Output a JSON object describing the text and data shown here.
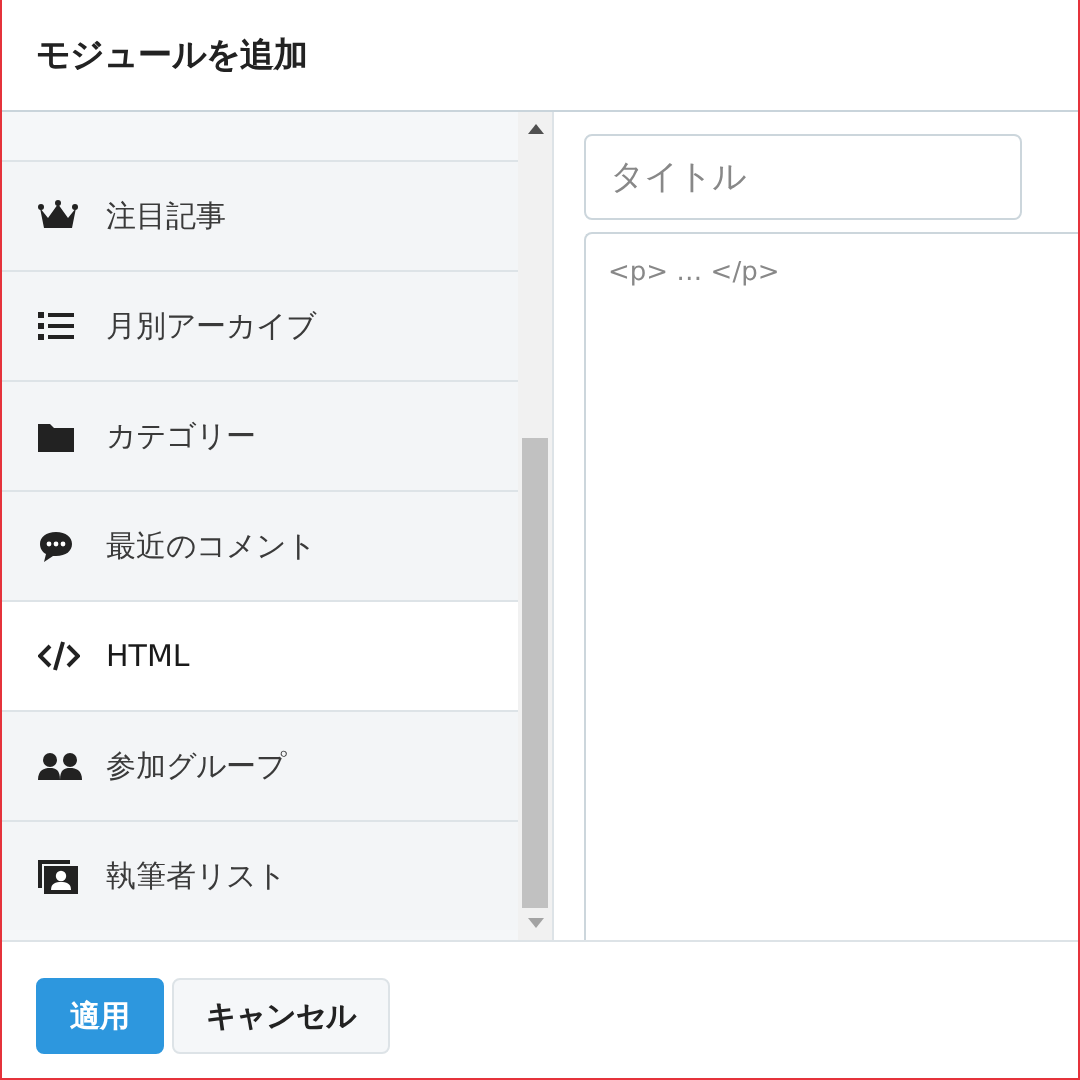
{
  "dialog": {
    "title": "モジュールを追加"
  },
  "modules": [
    {
      "label": "注目記事",
      "kind": "crown",
      "selected": false
    },
    {
      "label": "月別アーカイブ",
      "kind": "list",
      "selected": false
    },
    {
      "label": "カテゴリー",
      "kind": "folder",
      "selected": false
    },
    {
      "label": "最近のコメント",
      "kind": "comment",
      "selected": false
    },
    {
      "label": "HTML",
      "kind": "code",
      "selected": true
    },
    {
      "label": "参加グループ",
      "kind": "users",
      "selected": false
    },
    {
      "label": "執筆者リスト",
      "kind": "card",
      "selected": false
    }
  ],
  "editor": {
    "title_placeholder": "タイトル",
    "body_placeholder": "<p> … </p>"
  },
  "buttons": [
    {
      "label": "適用",
      "kind": "primary"
    },
    {
      "label": "キャンセル",
      "kind": "secondary"
    }
  ]
}
